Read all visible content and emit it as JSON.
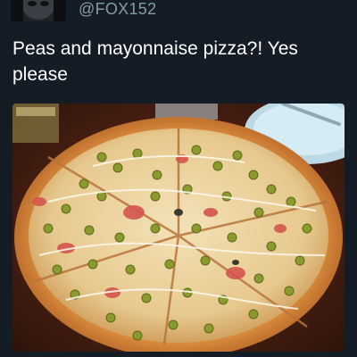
{
  "tweet": {
    "handle": "@FOX152",
    "text": "Peas and mayonnaise pizza?! Yes please"
  },
  "icons": {
    "avatar": "user-avatar",
    "media": "pizza-photo"
  },
  "colors": {
    "background": "#141d26",
    "handle": "#8899a6",
    "text": "#ffffff"
  }
}
